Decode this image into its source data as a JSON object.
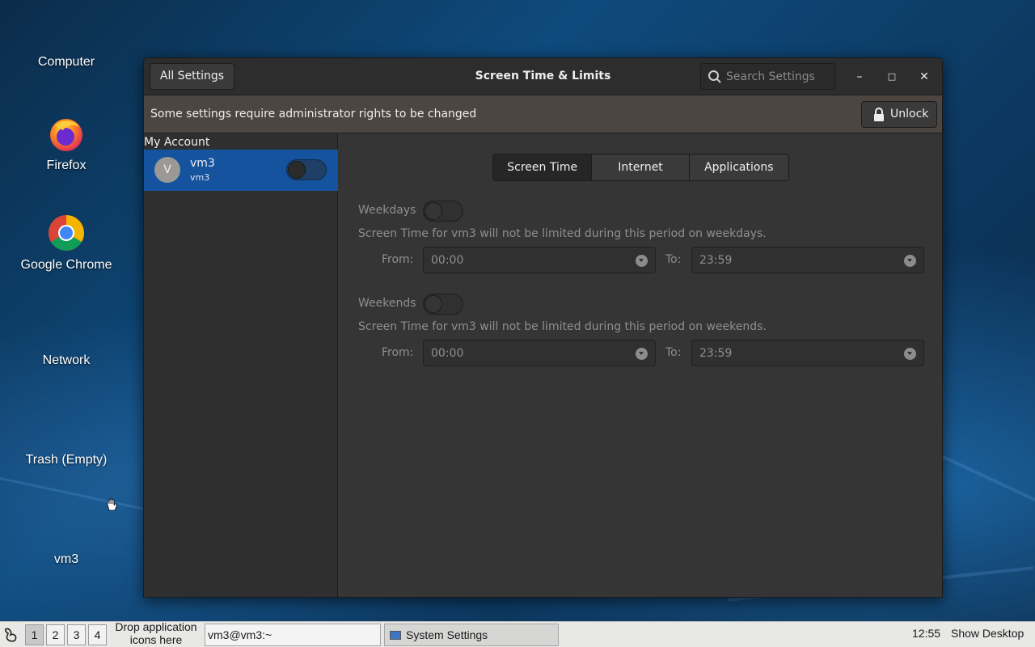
{
  "desktop": {
    "icons": [
      {
        "label": "Computer",
        "icon": "computer-icon"
      },
      {
        "label": "Firefox",
        "icon": "firefox-icon"
      },
      {
        "label": "Google Chrome",
        "icon": "chrome-icon"
      },
      {
        "label": "Network",
        "icon": "network-icon"
      },
      {
        "label": "Trash (Empty)",
        "icon": "trash-icon"
      },
      {
        "label": "vm3",
        "icon": "home-folder-icon"
      }
    ]
  },
  "window": {
    "all_settings_label": "All Settings",
    "title": "Screen Time & Limits",
    "search_placeholder": "Search Settings",
    "minimize_glyph": "–",
    "maximize_glyph": "□",
    "close_glyph": "✕"
  },
  "infobar": {
    "message": "Some settings require administrator rights to be changed",
    "unlock_label": "Unlock"
  },
  "sidebar": {
    "section_label": "My Account",
    "account": {
      "initial": "V",
      "name": "vm3",
      "username": "vm3",
      "enabled": false
    }
  },
  "tabs": [
    {
      "label": "Screen Time",
      "active": true
    },
    {
      "label": "Internet",
      "active": false
    },
    {
      "label": "Applications",
      "active": false
    }
  ],
  "screen_time": {
    "weekdays": {
      "label": "Weekdays",
      "enabled": false,
      "description": "Screen Time for vm3 will not be limited during this period on weekdays.",
      "from_label": "From:",
      "from_value": "00:00",
      "to_label": "To:",
      "to_value": "23:59"
    },
    "weekends": {
      "label": "Weekends",
      "enabled": false,
      "description": "Screen Time for vm3 will not be limited during this period on weekends.",
      "from_label": "From:",
      "from_value": "00:00",
      "to_label": "To:",
      "to_value": "23:59"
    }
  },
  "taskbar": {
    "workspaces": [
      "1",
      "2",
      "3",
      "4"
    ],
    "active_workspace": "1",
    "drop_hint": "Drop application icons here",
    "terminal_title": "vm3@vm3:~",
    "settings_title": "System Settings",
    "clock": "12:55",
    "show_desktop": "Show Desktop"
  }
}
